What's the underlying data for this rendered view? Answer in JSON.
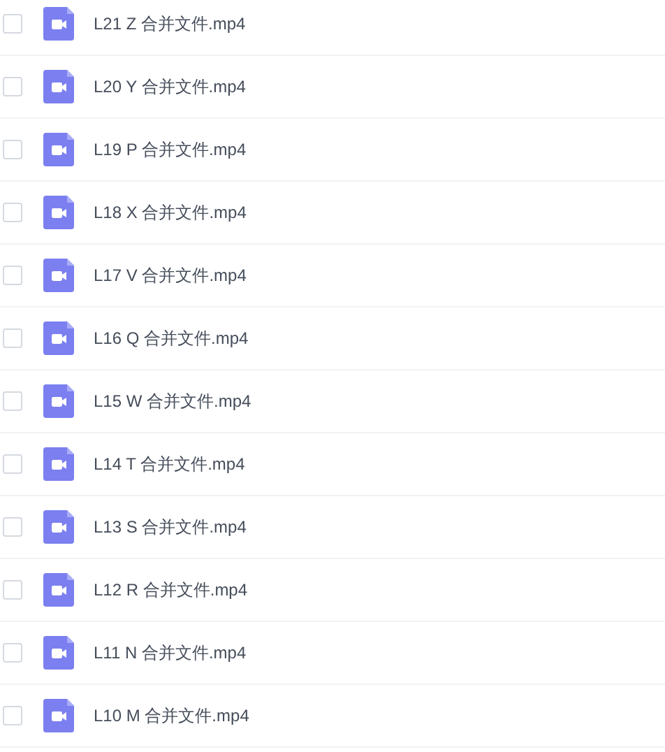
{
  "files": [
    {
      "name": "L21 Z 合并文件.mp4",
      "checked": false
    },
    {
      "name": "L20 Y 合并文件.mp4",
      "checked": false
    },
    {
      "name": "L19 P 合并文件.mp4",
      "checked": false
    },
    {
      "name": "L18 X 合并文件.mp4",
      "checked": false
    },
    {
      "name": "L17 V 合并文件.mp4",
      "checked": false
    },
    {
      "name": "L16 Q 合并文件.mp4",
      "checked": false
    },
    {
      "name": "L15 W 合并文件.mp4",
      "checked": false
    },
    {
      "name": "L14 T 合并文件.mp4",
      "checked": false
    },
    {
      "name": "L13 S 合并文件.mp4",
      "checked": false
    },
    {
      "name": "L12 R 合并文件.mp4",
      "checked": false
    },
    {
      "name": "L11 N 合并文件.mp4",
      "checked": false
    },
    {
      "name": "L10 M 合并文件.mp4",
      "checked": false
    }
  ]
}
